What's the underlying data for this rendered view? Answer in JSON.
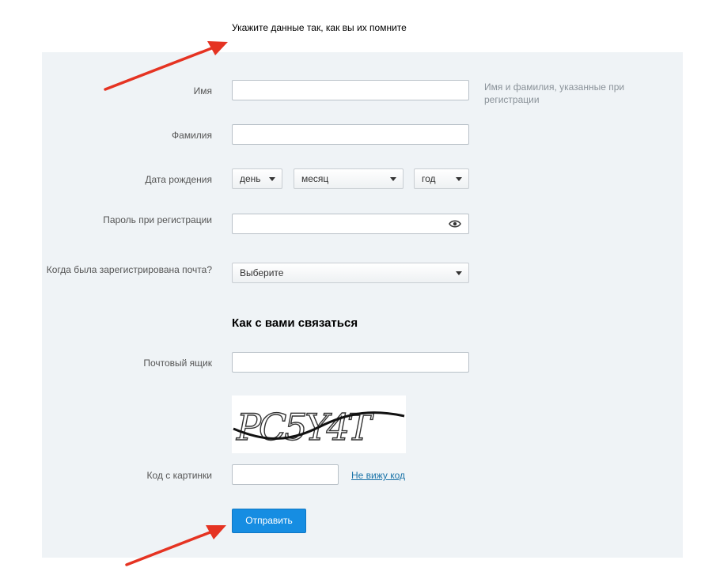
{
  "intro": "Укажите данные так, как вы их помните",
  "form": {
    "first_name": {
      "label": "Имя",
      "value": "",
      "hint": "Имя и фамилия, указанные при регистрации"
    },
    "last_name": {
      "label": "Фамилия",
      "value": ""
    },
    "birthdate": {
      "label": "Дата рождения",
      "day": "день",
      "month": "месяц",
      "year": "год"
    },
    "password": {
      "label": "Пароль при регистрации",
      "value": "",
      "toggle_icon": "eye-icon"
    },
    "registered_when": {
      "label": "Когда была зарегистрирована почта?",
      "selected": "Выберите"
    }
  },
  "contact": {
    "heading": "Как с вами связаться",
    "mailbox": {
      "label": "Почтовый ящик",
      "value": ""
    },
    "captcha": {
      "text": "PC5Y4T"
    },
    "code": {
      "label": "Код с картинки",
      "value": "",
      "cant_see_link": "Не вижу код"
    }
  },
  "submit_label": "Отправить",
  "colors": {
    "panel": "#eff3f6",
    "button": "#168de2",
    "link": "#1a73a8",
    "annotation_arrow": "#e53322"
  }
}
